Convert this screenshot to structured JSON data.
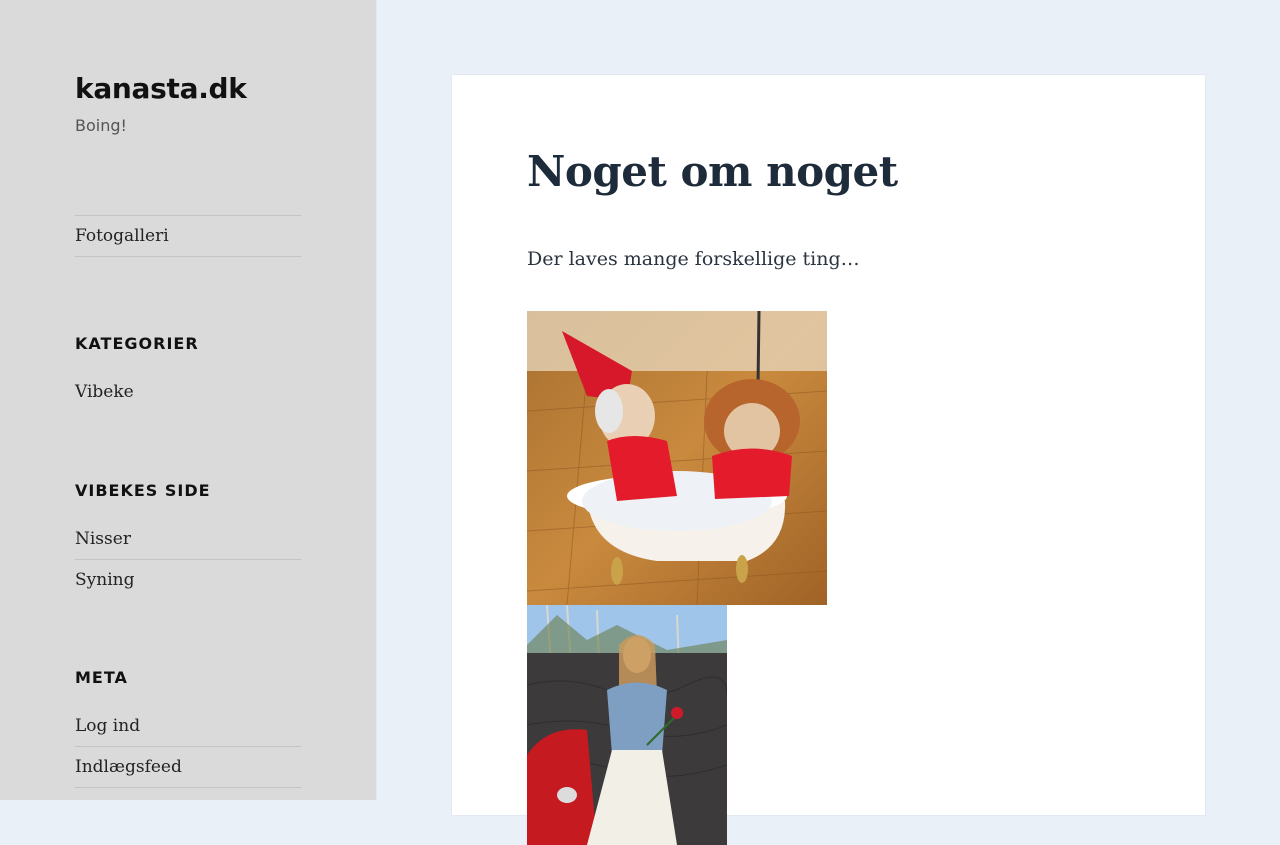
{
  "site": {
    "title": "kanasta.dk",
    "description": "Boing!"
  },
  "nav": {
    "items": [
      {
        "label": "Fotogalleri"
      }
    ]
  },
  "widgets": {
    "categories": {
      "title": "KATEGORIER",
      "items": [
        {
          "label": "Vibeke"
        }
      ]
    },
    "vibekes_side": {
      "title": "VIBEKES SIDE",
      "items": [
        {
          "label": "Nisser"
        },
        {
          "label": "Syning"
        }
      ]
    },
    "meta": {
      "title": "META",
      "items": [
        {
          "label": "Log ind"
        },
        {
          "label": "Indlægsfeed"
        }
      ]
    }
  },
  "post": {
    "title": "Noget om noget",
    "text": "Der laves mange forskellige ting…"
  },
  "colors": {
    "sidebar_bg": "#dadada",
    "page_bg": "#e9f0f7",
    "title_color": "#1e2b3a"
  }
}
